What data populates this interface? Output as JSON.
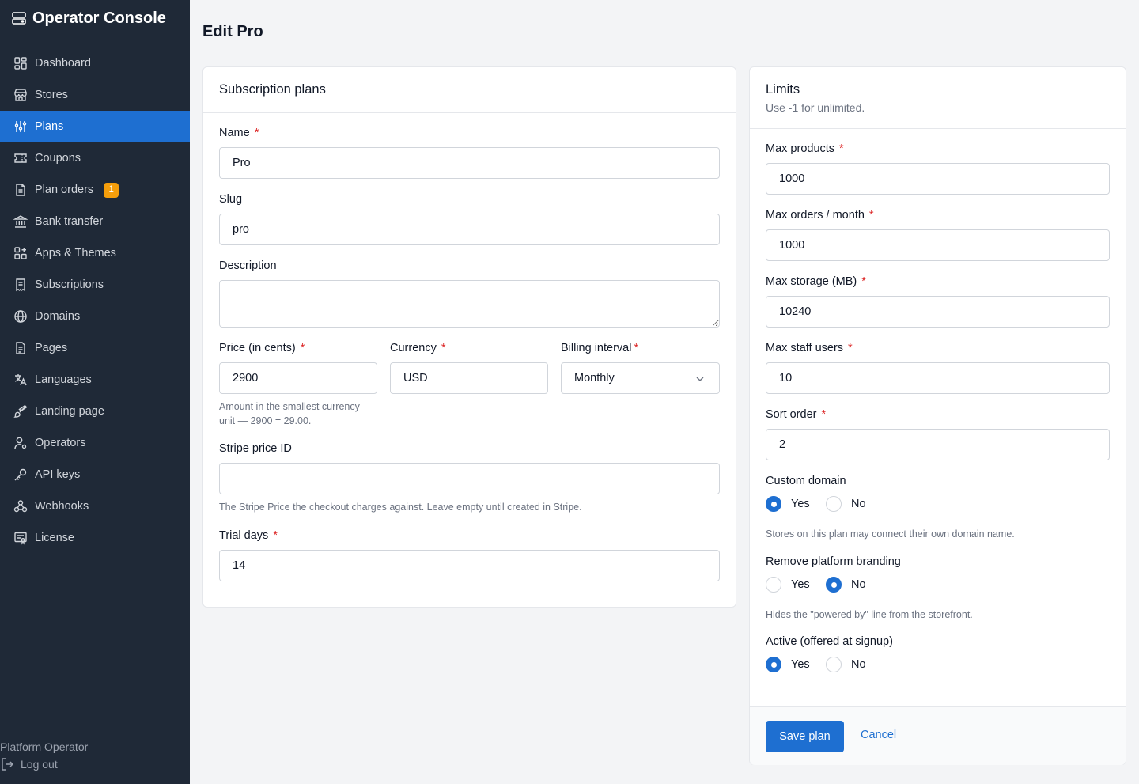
{
  "app": {
    "title": "Operator Console"
  },
  "sidebar": {
    "items": [
      {
        "label": "Dashboard",
        "icon": "dashboard-icon"
      },
      {
        "label": "Stores",
        "icon": "store-icon"
      },
      {
        "label": "Plans",
        "icon": "sliders-icon",
        "active": true
      },
      {
        "label": "Coupons",
        "icon": "ticket-icon"
      },
      {
        "label": "Plan orders",
        "icon": "document-icon",
        "badge": "1"
      },
      {
        "label": "Bank transfer",
        "icon": "bank-icon"
      },
      {
        "label": "Apps & Themes",
        "icon": "apps-icon"
      },
      {
        "label": "Subscriptions",
        "icon": "receipt-icon"
      },
      {
        "label": "Domains",
        "icon": "globe-icon"
      },
      {
        "label": "Pages",
        "icon": "page-icon"
      },
      {
        "label": "Languages",
        "icon": "languages-icon"
      },
      {
        "label": "Landing page",
        "icon": "brush-icon"
      },
      {
        "label": "Operators",
        "icon": "user-gear-icon"
      },
      {
        "label": "API keys",
        "icon": "key-icon"
      },
      {
        "label": "Webhooks",
        "icon": "webhook-icon"
      },
      {
        "label": "License",
        "icon": "license-icon"
      }
    ],
    "user": "Platform Operator",
    "logout": "Log out"
  },
  "page": {
    "title": "Edit Pro"
  },
  "plan_card": {
    "title": "Subscription plans",
    "name": {
      "label": "Name",
      "value": "Pro"
    },
    "slug": {
      "label": "Slug",
      "value": "pro"
    },
    "description": {
      "label": "Description",
      "value": ""
    },
    "price": {
      "label": "Price (in cents)",
      "value": "2900",
      "help": "Amount in the smallest currency unit — 2900 = 29.00."
    },
    "currency": {
      "label": "Currency",
      "value": "USD"
    },
    "billing": {
      "label": "Billing interval",
      "value": "Monthly"
    },
    "stripe": {
      "label": "Stripe price ID",
      "value": "",
      "help": "The Stripe Price the checkout charges against. Leave empty until created in Stripe."
    },
    "trial": {
      "label": "Trial days",
      "value": "14"
    }
  },
  "limits_card": {
    "title": "Limits",
    "subtitle": "Use -1 for unlimited.",
    "max_products": {
      "label": "Max products",
      "value": "1000"
    },
    "max_orders": {
      "label": "Max orders / month",
      "value": "1000"
    },
    "max_storage": {
      "label": "Max storage (MB)",
      "value": "10240"
    },
    "max_staff": {
      "label": "Max staff users",
      "value": "10"
    },
    "sort_order": {
      "label": "Sort order",
      "value": "2"
    },
    "custom_domain": {
      "label": "Custom domain",
      "selected": "Yes",
      "help": "Stores on this plan may connect their own domain name."
    },
    "remove_branding": {
      "label": "Remove platform branding",
      "selected": "No",
      "help": "Hides the \"powered by\" line from the storefront."
    },
    "active": {
      "label": "Active (offered at signup)",
      "selected": "Yes"
    },
    "yes_label": "Yes",
    "no_label": "No",
    "required_mark": "*"
  },
  "actions": {
    "save": "Save plan",
    "cancel": "Cancel"
  },
  "colors": {
    "sidebar_bg": "#1f2937",
    "accent": "#1e6fd1",
    "badge": "#f59e0b",
    "required": "#dc2626"
  }
}
